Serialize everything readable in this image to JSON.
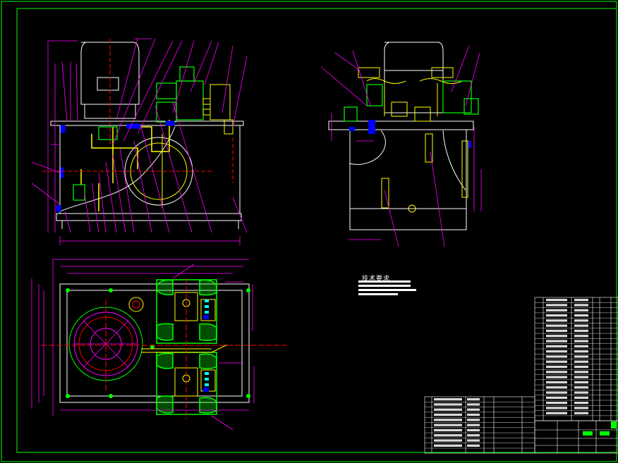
{
  "drawing": {
    "notes_title": "技术要求",
    "colors": {
      "background": "#000000",
      "frame": "#00ff00",
      "outline": "#ffffff",
      "dimension": "#ff00ff",
      "part": "#ffff00",
      "component": "#00ff00",
      "accent_blue": "#0000ff",
      "accent_red": "#ff0000",
      "accent_cyan": "#00ffff"
    },
    "views": [
      "front-view",
      "side-view",
      "top-view"
    ]
  }
}
